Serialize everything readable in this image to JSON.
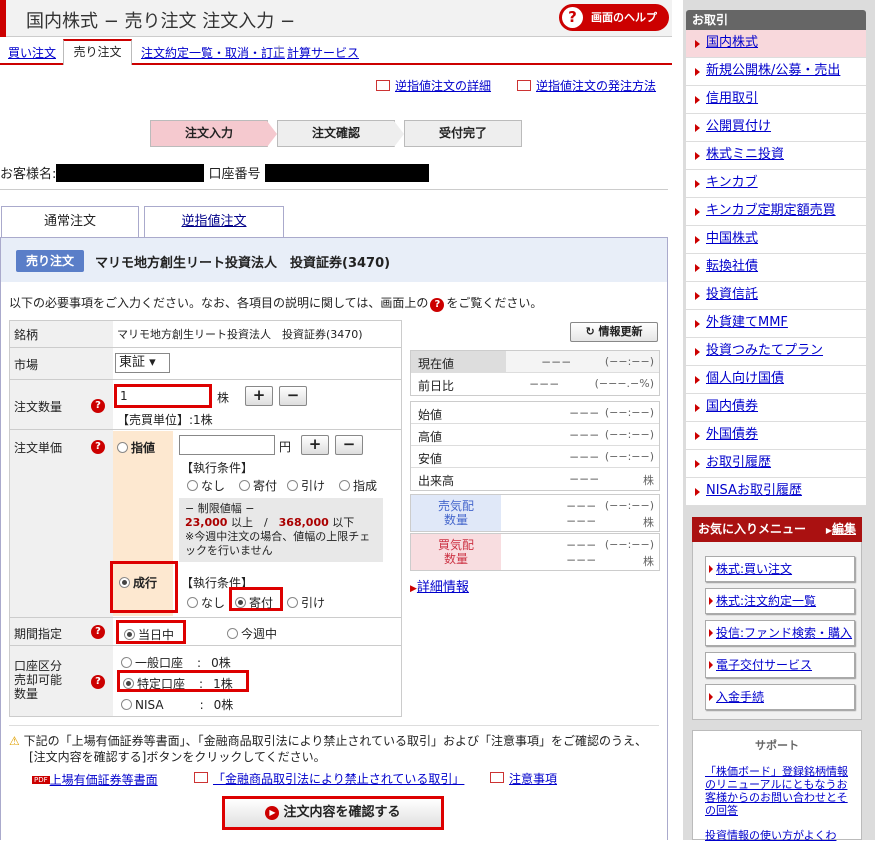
{
  "header": {
    "title": "国内株式 − 売り注文 注文入力 −",
    "help": "画面のヘルプ"
  },
  "subtabs": {
    "buy": "買い注文",
    "sell": "売り注文",
    "list": "注文約定一覧・取消・訂正",
    "calc": "計算サービス"
  },
  "gyaku": {
    "detail": "逆指値注文の詳細",
    "how": "逆指値注文の発注方法"
  },
  "steps": [
    "注文入力",
    "注文確認",
    "受付完了"
  ],
  "customer": {
    "name_label": "お客様名:",
    "account_label": "口座番号"
  },
  "tabs": {
    "normal": "通常注文",
    "reverse": "逆指値注文"
  },
  "order": {
    "badge": "売り注文",
    "stock": "マリモ地方創生リート投資法人　投資証券(3470)"
  },
  "instructions": {
    "before": "以下の必要事項をご入力ください。なお、各項目の説明に関しては、画面上の",
    "after": "をご覧ください。"
  },
  "form": {
    "brand_label": "銘柄",
    "brand_value": "マリモ地方創生リート投資法人　投資証券(3470)",
    "market_label": "市場",
    "market_value": "東証 ▾",
    "qty_label": "注文数量",
    "qty_value": "1",
    "qty_unit": "株",
    "unit_note": "【売買単位】:1株",
    "price_label": "注文単価",
    "limit_label": "指値",
    "yen": "円",
    "exec_cond": "【執行条件】",
    "cond_none": "なし",
    "cond_open": "寄付",
    "cond_close": "引け",
    "cond_sashi": "指成",
    "range_title": "− 制限値幅 −",
    "range_low": "23,000",
    "range_mid": " 以上　/　",
    "range_high": "368,000",
    "range_tail": " 以下",
    "range_note": "※今週中注文の場合、値幅の上限チェックを行いません",
    "market_order": "成行",
    "exec_cond2": "【執行条件】",
    "period_label": "期間指定",
    "today": "当日中",
    "this_week": "今週中",
    "acct_label1": "口座区分",
    "acct_label2": "売却可能",
    "acct_label3": "数量",
    "acct_general": "一般口座",
    "acct_general_qty": "0株",
    "acct_special": "特定口座",
    "acct_special_qty": "1株",
    "acct_nisa": "NISA",
    "acct_nisa_qty": "0株",
    "colon": ":",
    "plus": "+",
    "minus": "−",
    "qm": "?"
  },
  "info": {
    "refresh": "情報更新",
    "current_label": "現在値",
    "current_value": "−−−",
    "current_time": "(−−:−−)",
    "change_label": "前日比",
    "change_value": "−−−",
    "change_pct": "(−−−.−%)",
    "rows": [
      {
        "k": "始値",
        "v": "−−−",
        "p": "(−−:−−)"
      },
      {
        "k": "高値",
        "v": "−−−",
        "p": "(−−:−−)"
      },
      {
        "k": "安値",
        "v": "−−−",
        "p": "(−−:−−)"
      },
      {
        "k": "出来高",
        "v": "−−−",
        "p": "株"
      }
    ],
    "sell_q1": "売気配",
    "sell_q2": "数量",
    "buy_q1": "買気配",
    "buy_q2": "数量",
    "q_val": "−−−",
    "q_time": "(−−:−−)",
    "q_unit": "株",
    "detail": "詳細情報"
  },
  "notes": {
    "text1": "下記の「上場有価証券等書面」、「金融商品取引法により禁止されている取引」および「注意事項」をご確認のうえ、",
    "text2": "[注文内容を確認する]ボタンをクリックしてください。",
    "link1": "上場有価証券等書面",
    "link2": "「金融商品取引法により禁止されている取引」",
    "link3": "注意事項",
    "pdf": "PDF"
  },
  "submit": "注文内容を確認する",
  "sidebar": {
    "header": "お取引",
    "items": [
      "国内株式",
      "新規公開株/公募・売出",
      "信用取引",
      "公開買付け",
      "株式ミニ投資",
      "キンカブ",
      "キンカブ定期定額売買",
      "中国株式",
      "転換社債",
      "投資信託",
      "外貨建てMMF",
      "投資つみたてプラン",
      "個人向け国債",
      "国内債券",
      "外国債券",
      "お取引履歴",
      "NISAお取引履歴"
    ],
    "fav_header": "お気に入りメニュー",
    "fav_edit": "編集",
    "fav_items": [
      "株式:買い注文",
      "株式:注文約定一覧",
      "投信:ファンド検索・購入",
      "電子交付サービス",
      "入金手続"
    ],
    "support": "サポート",
    "support_text": "「株価ボード」登録銘柄情報のリニューアルにともなうお客様からのお問い合わせとその回答",
    "support_text2": "投資情報の使い方がよくわ"
  }
}
